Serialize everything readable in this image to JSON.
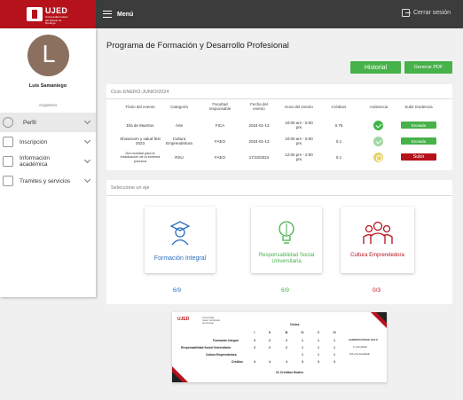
{
  "header": {
    "logo_text": "UJED",
    "logo_subtitle": "Universidad Juárez del Estado de Durango",
    "menu_label": "Menú",
    "logout_label": "Cerrar sesión"
  },
  "sidebar": {
    "avatar_letter": "L",
    "user_name": "Luis Samaniego",
    "user_department": "Arquitecto",
    "items": [
      {
        "label": "Perfil",
        "icon": "user-icon",
        "active": true
      },
      {
        "label": "Inscripción",
        "icon": "form-icon",
        "active": false
      },
      {
        "label": "Información académica",
        "icon": "book-icon",
        "active": false
      },
      {
        "label": "Tramites y servicios",
        "icon": "document-icon",
        "active": false
      }
    ]
  },
  "main": {
    "title": "Programa de Formación y Desarrollo Profesional",
    "historial_button": "Historial",
    "pdf_button": "Generar PDF",
    "cycle_label": "Ciclo ENERO-JUNIO/2024",
    "table": {
      "headers": [
        "Título del evento",
        "Categoría",
        "Facultad responsable",
        "Fecha del evento",
        "Hora del evento",
        "Créditos",
        "Asistencia",
        "Subir Evidencia"
      ],
      "rows": [
        {
          "title": "Día de Muertos",
          "category": "Arte",
          "faculty": "FICA",
          "date": "2024-01-13",
          "time": "10:00 am - 5:00 pm",
          "credits": "0.75",
          "attendance": "green",
          "evidence": "Enviada",
          "evidence_color": "green"
        },
        {
          "title": "Showroom y salud fest 2023",
          "category": "Cultura Emprendedora",
          "faculty": "FAEO",
          "date": "2024-01-13",
          "time": "10:00 am - 5:00 pm",
          "credits": "0.1",
          "attendance": "lightgreen",
          "evidence": "Enviada",
          "evidence_color": "green"
        },
        {
          "title": "Día mundial para la erradicación de la extrema pobreza",
          "category": "RSU",
          "faculty": "FAEO",
          "date": "17/10/2024",
          "time": "12:00 pm - 2:00 pm",
          "credits": "0.1",
          "attendance": "yellow",
          "evidence": "Subir",
          "evidence_color": "red"
        }
      ]
    },
    "axis_label": "Seleccione un eje",
    "axes": [
      {
        "name": "Formación Integral",
        "count": "6/9",
        "color": "#2a6ebb",
        "icon": "graduate-icon"
      },
      {
        "name": "Responsabilidad Social Universitaria",
        "count": "6/9",
        "color": "#47b14a",
        "icon": "lightbulb-icon"
      },
      {
        "name": "Cultura Emprendedora",
        "count": "0/3",
        "color": "#b5121b",
        "icon": "group-icon"
      }
    ],
    "credits_grid": {
      "logo": "UJED",
      "logo_subtitle": "Universidad Juárez del Estado de Durango",
      "heading": "Ciclos",
      "columns": [
        "I",
        "II",
        "III",
        "IV",
        "V",
        "VI"
      ],
      "rows": [
        {
          "label": "Formación Integral",
          "values": [
            "2",
            "2",
            "2",
            "1",
            "1",
            "1"
          ]
        },
        {
          "label": "Responsabilidad Social Universitaria",
          "values": [
            "2",
            "2",
            "2",
            "1",
            "1",
            "1"
          ]
        },
        {
          "label": "Cultura Emprendedora",
          "values": [
            "",
            "",
            "",
            "1",
            "1",
            "1"
          ]
        },
        {
          "label": "Créditos",
          "values": [
            "4",
            "4",
            "4",
            "3",
            "3",
            "3"
          ]
        }
      ],
      "legend": [
        "ACREDITACIÓN DE CICLO",
        "1+ Acreditado",
        "N/A+ No Acreditado"
      ],
      "total": "21 Créditos finales"
    }
  }
}
